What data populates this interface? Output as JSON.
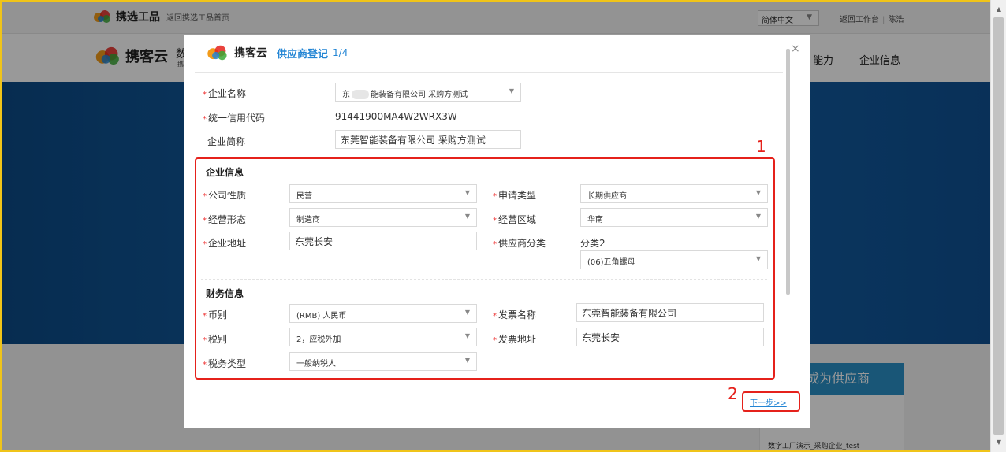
{
  "topbar": {
    "brand": "携选工品",
    "back_link": "返回携选工品首页",
    "language": "简体中文",
    "workbench_link": "返回工作台",
    "user_link": "陈浩"
  },
  "header": {
    "brand": "携客云",
    "brand_sub": "XIEKEYUN",
    "nav_trunc_1": "数",
    "nav_trunc_2": "携",
    "nav_capability": "能力",
    "nav_company": "企业信息"
  },
  "background": {
    "become_supplier": "成为供应商",
    "company_line": "数字工厂演示_采购企业_test"
  },
  "modal": {
    "brand": "携客云",
    "brand_sub": "XIEKEYUN",
    "title": "供应商登记",
    "step": "1/4",
    "close": "×",
    "basic": {
      "company_name_label": "企业名称",
      "company_name_prefix": "东",
      "company_name_suffix": "能装备有限公司 采购方测试",
      "credit_code_label": "统一信用代码",
      "credit_code": "91441900MA4W2WRX3W",
      "short_name_label": "企业简称",
      "short_name": "东莞智能装备有限公司 采购方测试"
    },
    "company_info": {
      "section_title": "企业信息",
      "nature_label": "公司性质",
      "nature": "民营",
      "apply_type_label": "申请类型",
      "apply_type": "长期供应商",
      "business_form_label": "经营形态",
      "business_form": "制造商",
      "region_label": "经营区域",
      "region": "华南",
      "address_label": "企业地址",
      "address": "东莞长安",
      "supplier_class_label": "供应商分类",
      "supplier_class": "分类2",
      "supplier_class_sub": "(06)五角螺母"
    },
    "finance_info": {
      "section_title": "财务信息",
      "currency_label": "币别",
      "currency": "(RMB) 人民币",
      "invoice_name_label": "发票名称",
      "invoice_name": "东莞智能装备有限公司",
      "tax_label": "税别",
      "tax": "2，应税外加",
      "invoice_address_label": "发票地址",
      "invoice_address": "东莞长安",
      "tax_type_label": "税务类型",
      "tax_type": "一般纳税人"
    },
    "next": "下一步>>"
  },
  "annotations": {
    "box1_number": "1",
    "box2_number": "2",
    "color": "#e5211b"
  },
  "colors": {
    "accent": "#2385d4",
    "required": "#e33",
    "banner": "#1566ac"
  }
}
